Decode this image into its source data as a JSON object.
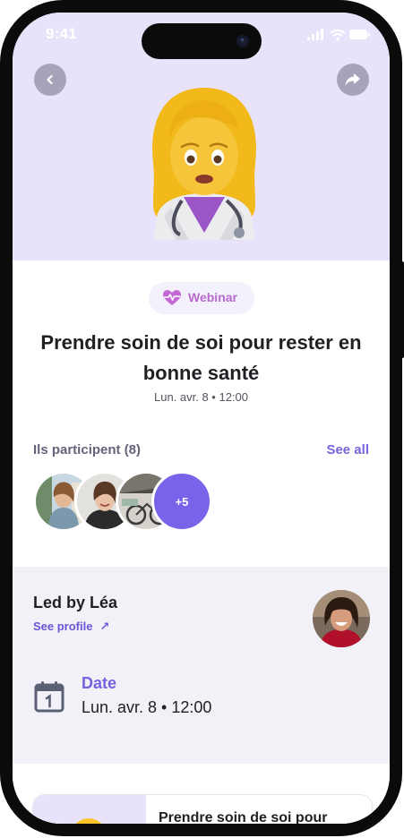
{
  "status_bar": {
    "time": "9:41"
  },
  "nav": {
    "back_icon": "chevron-left-icon",
    "share_icon": "share-arrow-icon"
  },
  "hero": {
    "emoji": "woman-health-worker-emoji",
    "background": "#e8e3fb"
  },
  "event": {
    "badge_label": "Webinar",
    "badge_icon": "heart-pulse-icon",
    "title_line1": "Prendre soin de soi pour rester en",
    "title_line2": "bonne santé",
    "datetime": "Lun. avr. 8 • 12:00"
  },
  "participants": {
    "label": "Ils participent (8)",
    "see_all": "See all",
    "more_count": "+5"
  },
  "host": {
    "led_by": "Led by Léa",
    "see_profile": "See profile",
    "see_profile_arrow": "↗"
  },
  "date_section": {
    "label": "Date",
    "value": "Lun. avr. 8 • 12:00"
  },
  "related_card": {
    "title": "Prendre soin de soi pour"
  },
  "colors": {
    "accent": "#7864e8",
    "badge_text": "#b86ad0",
    "lavender_bg": "#f2f1f8"
  }
}
